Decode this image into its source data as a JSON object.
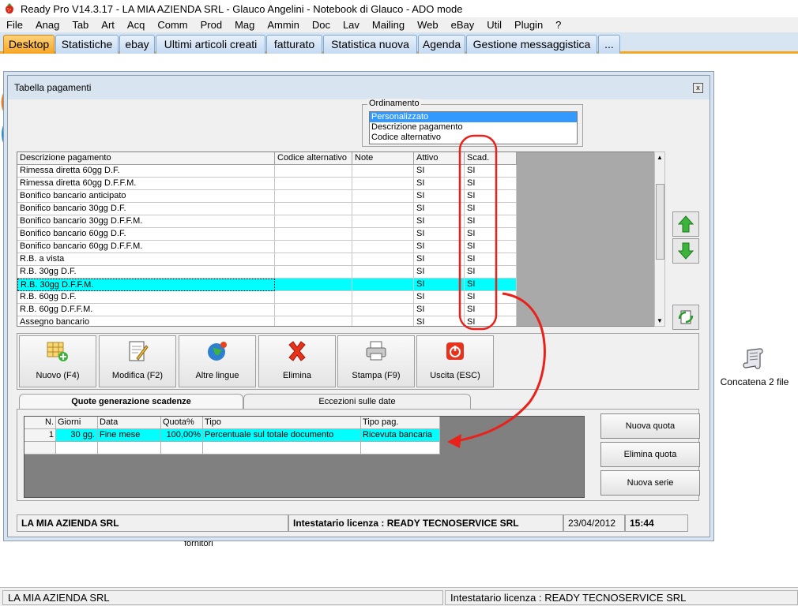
{
  "window": {
    "title": "Ready Pro V14.3.17 - LA MIA AZIENDA SRL - Glauco Angelini - Notebook di Glauco - ADO mode"
  },
  "menu": [
    "File",
    "Anag",
    "Tab",
    "Art",
    "Acq",
    "Comm",
    "Prod",
    "Mag",
    "Ammin",
    "Doc",
    "Lav",
    "Mailing",
    "Web",
    "eBay",
    "Util",
    "Plugin",
    "?"
  ],
  "tabs": [
    "Desktop",
    "Statistiche",
    "ebay",
    "Ultimi articoli creati",
    "fatturato",
    "Statistica nuova",
    "Agenda",
    "Gestione messaggistica",
    "..."
  ],
  "desktop_icons": {
    "concatena": "Concatena 2 file",
    "fornitori": "fornitori"
  },
  "status": {
    "company": "LA MIA AZIENDA SRL",
    "license": "Intestatario licenza : READY TECNOSERVICE SRL"
  },
  "dialog": {
    "title": "Tabella pagamenti",
    "close": "x",
    "ordinamento": {
      "legend": "Ordinamento",
      "options": [
        "Personalizzato",
        "Descrizione pagamento",
        "Codice alternativo"
      ],
      "selected": "Personalizzato"
    },
    "columns": [
      "Descrizione pagamento",
      "Codice alternativo",
      "Note",
      "Attivo",
      "Scad."
    ],
    "rows": [
      {
        "desc": "Rimessa diretta 60gg D.F.",
        "codice": "",
        "note": "",
        "attivo": "SI",
        "scad": "SI"
      },
      {
        "desc": "Rimessa diretta 60gg D.F.F.M.",
        "codice": "",
        "note": "",
        "attivo": "SI",
        "scad": "SI"
      },
      {
        "desc": "Bonifico bancario anticipato",
        "codice": "",
        "note": "",
        "attivo": "SI",
        "scad": "SI"
      },
      {
        "desc": "Bonifico bancario 30gg D.F.",
        "codice": "",
        "note": "",
        "attivo": "SI",
        "scad": "SI"
      },
      {
        "desc": "Bonifico bancario 30gg D.F.F.M.",
        "codice": "",
        "note": "",
        "attivo": "SI",
        "scad": "SI"
      },
      {
        "desc": "Bonifico bancario 60gg D.F.",
        "codice": "",
        "note": "",
        "attivo": "SI",
        "scad": "SI"
      },
      {
        "desc": "Bonifico bancario 60gg D.F.F.M.",
        "codice": "",
        "note": "",
        "attivo": "SI",
        "scad": "SI"
      },
      {
        "desc": "R.B. a vista",
        "codice": "",
        "note": "",
        "attivo": "SI",
        "scad": "SI"
      },
      {
        "desc": "R.B. 30gg D.F.",
        "codice": "",
        "note": "",
        "attivo": "SI",
        "scad": "SI"
      },
      {
        "desc": "R.B. 30gg D.F.F.M.",
        "codice": "",
        "note": "",
        "attivo": "SI",
        "scad": "SI"
      },
      {
        "desc": "R.B. 60gg D.F.",
        "codice": "",
        "note": "",
        "attivo": "SI",
        "scad": "SI"
      },
      {
        "desc": "R.B. 60gg D.F.F.M.",
        "codice": "",
        "note": "",
        "attivo": "SI",
        "scad": "SI"
      },
      {
        "desc": "Assegno bancario",
        "codice": "",
        "note": "",
        "attivo": "SI",
        "scad": "SI"
      }
    ],
    "selected_row": 9,
    "toolbar": {
      "nuovo": "Nuovo (F4)",
      "modifica": "Modifica (F2)",
      "lingue": "Altre lingue",
      "elimina": "Elimina",
      "stampa": "Stampa (F9)",
      "uscita": "Uscita (ESC)"
    },
    "subtabs": [
      "Quote generazione scadenze",
      "Eccezioni sulle date"
    ],
    "quote": {
      "columns": [
        "N.",
        "Giorni",
        "Data",
        "Quota%",
        "Tipo",
        "Tipo pag."
      ],
      "rows": [
        {
          "n": "1",
          "giorni": "30 gg.",
          "data": "Fine mese",
          "quota": "100,00%",
          "tipo": "Percentuale sul totale documento",
          "tipopag": "Ricevuta bancaria"
        }
      ]
    },
    "buttons": {
      "nuova_quota": "Nuova quota",
      "elimina_quota": "Elimina quota",
      "nuova_serie": "Nuova serie"
    },
    "status": {
      "company": "LA MIA AZIENDA SRL",
      "license": "Intestatario licenza : READY TECNOSERVICE SRL",
      "date": "23/04/2012",
      "time": "15:44"
    }
  },
  "colors": {
    "selection": "#00ffff",
    "active_tab": "#f5a623",
    "annotation": "#e8221b"
  }
}
